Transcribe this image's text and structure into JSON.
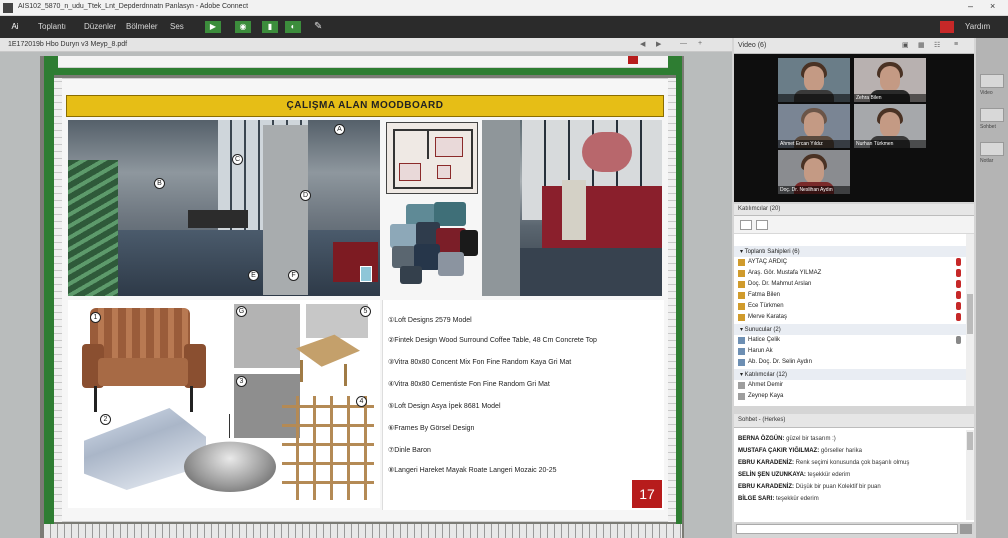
{
  "window": {
    "title": "AIS102_5870_n_udu_Ttek_Lnt_Depderdnnatn Panlasyn - Adobe Connect",
    "minimize": "–",
    "close": "×"
  },
  "menu": {
    "items": [
      "Toplantı",
      "Düzenler",
      "Bölmeler",
      "Ses"
    ],
    "tool_labels": [
      "▶",
      "◉",
      "▮",
      "◐",
      "✎"
    ],
    "help": "Yardım"
  },
  "share_pod": {
    "filename": "1E172019b Hbo Duryn v3 Meyp_8.pdf",
    "page_controls": [
      "◀",
      "▶",
      "—",
      "+"
    ]
  },
  "moodboard": {
    "title": "ÇALIŞMA ALAN MOODBOARD",
    "page_number": "17",
    "callouts": [
      "1",
      "2",
      "3",
      "4",
      "5",
      "A",
      "B",
      "C",
      "D",
      "E",
      "F",
      "G"
    ],
    "items": [
      "①Loft Designs 2579 Model",
      "②Fintek Design Wood Surround Coffee Table, 48 Cm Concrete Top",
      "③Vitra 80x80 Concent Mix Fon Fine Random Kaya Gri Mat",
      "④Vitra 80x80 Cementiste Fon Fine Random Gri Mat",
      "⑤Loft Design Asya İpek 8681 Model",
      "⑥Frames By Görsel Design",
      "⑦Dinle Baron",
      "⑧Langeri Hareket Mayak Roate Langeri Mozaic 20-25"
    ]
  },
  "video": {
    "header": "Video (6)",
    "participants": [
      {
        "name": ""
      },
      {
        "name": "Zehra Bilen"
      },
      {
        "name": "Ahmet Ercan Yıldız"
      },
      {
        "name": "Nurhan Türkmen"
      },
      {
        "name": "Doç. Dr. Neslihan Aydın"
      }
    ]
  },
  "attendees": {
    "header": "Katılımcılar (20)",
    "rows": [
      {
        "type": "group",
        "text": "▾ Toplantı Sahipleri (6)"
      },
      {
        "type": "person",
        "text": "AYTAÇ ARDIÇ"
      },
      {
        "type": "person",
        "text": "Araş. Gör. Mustafa YILMAZ"
      },
      {
        "type": "person",
        "text": "Doç. Dr. Mahmut Arslan"
      },
      {
        "type": "person",
        "text": "Fatma Bilen"
      },
      {
        "type": "person",
        "text": "Ece Türkmen"
      },
      {
        "type": "person",
        "text": "Merve Karataş"
      },
      {
        "type": "group",
        "text": "▾ Sunucular (2)"
      },
      {
        "type": "person",
        "text": "Hatice Çelik"
      },
      {
        "type": "person",
        "text": "Harun Ak"
      },
      {
        "type": "person",
        "text": "Ab. Doç. Dr. Selin Aydın"
      },
      {
        "type": "group",
        "text": "▾ Katılımcılar (12)"
      },
      {
        "type": "person",
        "text": "Ahmet Demir"
      },
      {
        "type": "person",
        "text": "Zeynep Kaya"
      }
    ]
  },
  "chat": {
    "header": "Sohbet - (Herkes)",
    "lines": [
      {
        "who": "BERNA ÖZGÜN:",
        "msg": "güzel bir tasarım :)"
      },
      {
        "who": "MUSTAFA ÇAKIR YIĞILMAZ:",
        "msg": "görseller harika"
      },
      {
        "who": "EBRU KARADENİZ:",
        "msg": "Renk seçimi konusunda çok başarılı olmuş"
      },
      {
        "who": "SELİN ŞEN UZUNKAYA:",
        "msg": "teşekkür ederim"
      },
      {
        "who": "EBRU KARADENİZ:",
        "msg": "Düşük bir puan Kolektif bir puan"
      },
      {
        "who": "BİLGE SARI:",
        "msg": "teşekkür ederim"
      }
    ]
  },
  "far_pods": [
    {
      "label": "Video"
    },
    {
      "label": "Sohbet"
    },
    {
      "label": "Notlar"
    }
  ],
  "colors": {
    "title_gold": "#e6be16",
    "frame_green": "#2e7d32",
    "accent_red": "#b71c1c",
    "menubar": "#2b2b2b"
  }
}
